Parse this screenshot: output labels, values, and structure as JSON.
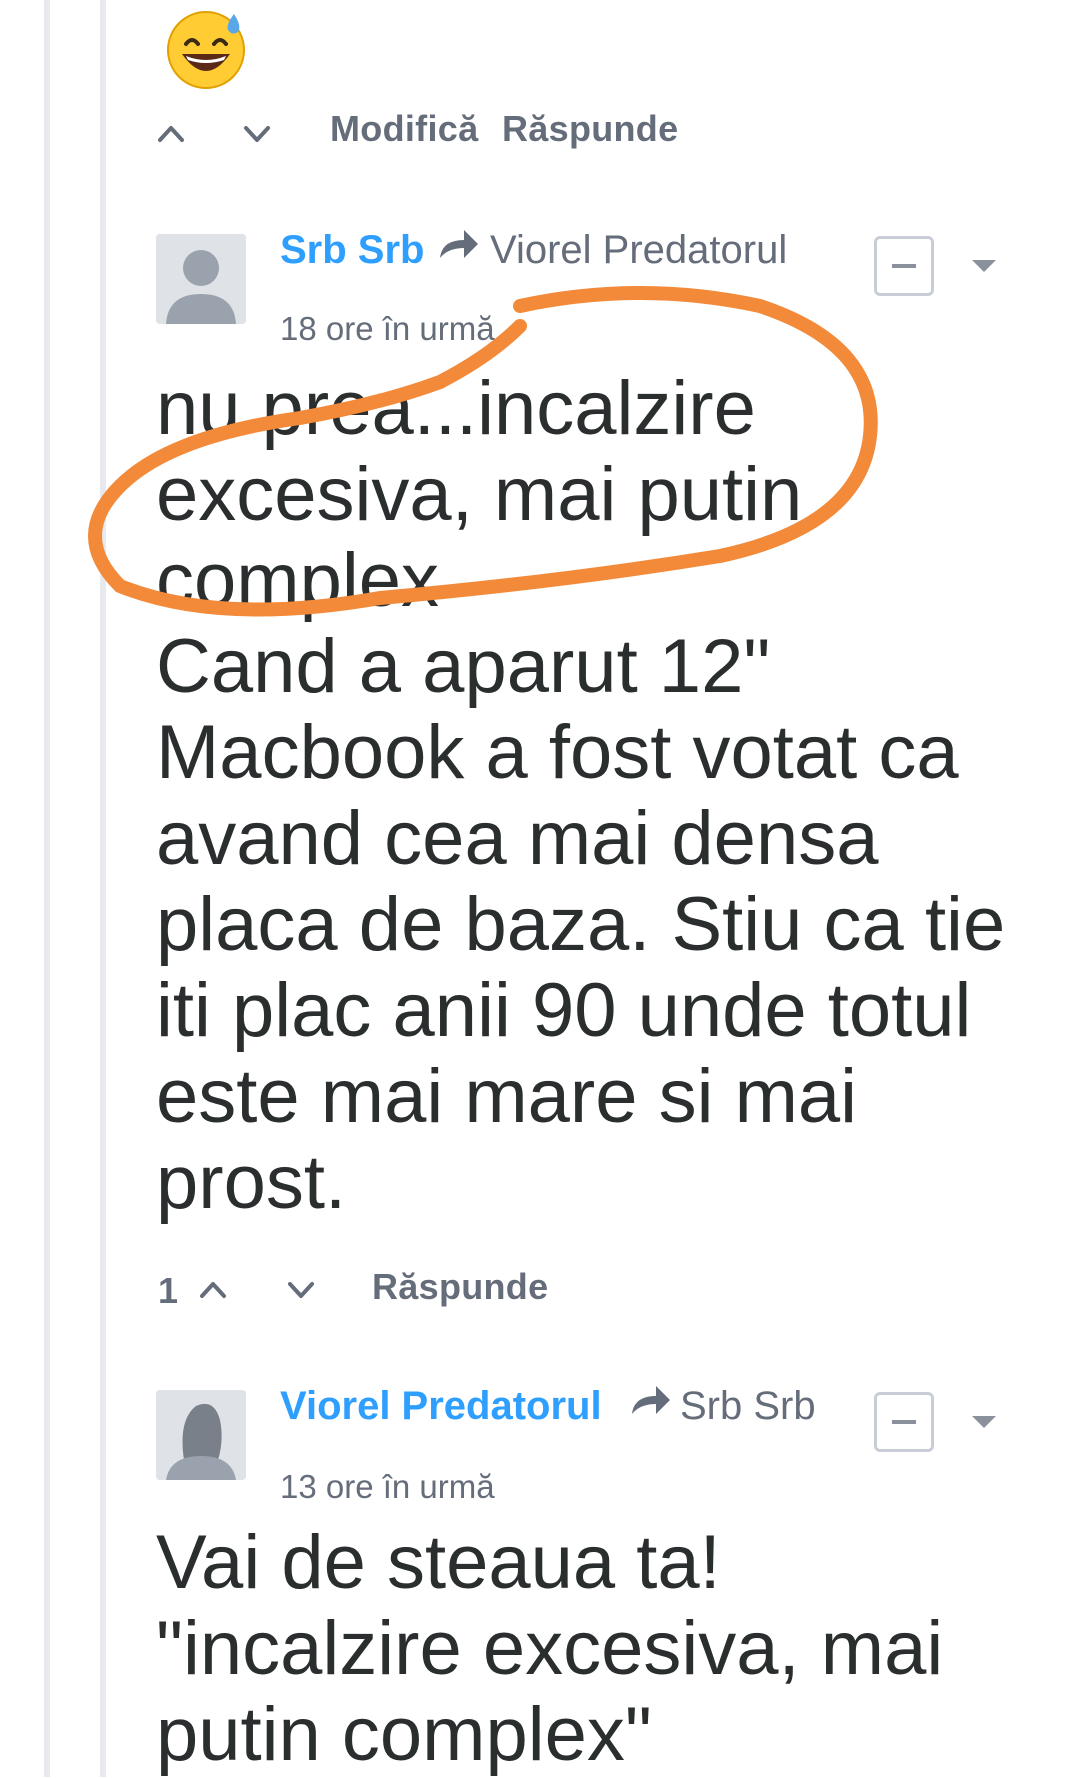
{
  "colors": {
    "author": "#2e9fff",
    "muted": "#656c7a",
    "text": "#2a2e2e",
    "highlight": "#f28a3a"
  },
  "prev_comment": {
    "emoji": "grinning-sweat-emoji",
    "actions": {
      "edit": "Modifică",
      "reply": "Răspunde"
    }
  },
  "comments": [
    {
      "author": "Srb Srb",
      "reply_to": "Viorel Predatorul",
      "time": "18 ore în urmă",
      "lines": [
        "nu prea...incalzire",
        "excesiva, mai putin",
        "complex",
        "Cand a aparut 12\"",
        "Macbook a fost votat ca",
        "avand cea mai densa",
        "placa de baza. Stiu ca tie",
        "iti plac anii 90 unde totul",
        "este mai mare si mai",
        "prost."
      ],
      "votes": "1",
      "reply_label": "Răspunde"
    },
    {
      "author": "Viorel Predatorul",
      "reply_to": "Srb Srb",
      "time": "13 ore în urmă",
      "lines": [
        "Vai de steaua ta!",
        "\"incalzire excesiva, mai",
        "putin complex\""
      ]
    }
  ]
}
